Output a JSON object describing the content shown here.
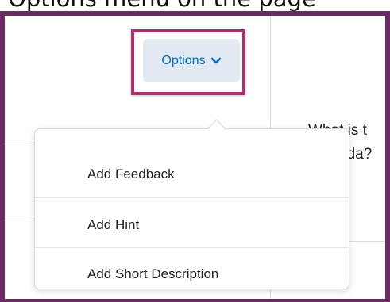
{
  "caption": "Options menu on the page",
  "background": {
    "question_lines": [
      "What is t",
      "nda?"
    ]
  },
  "options_button": {
    "label": "Options",
    "icon": "chevron-down-icon"
  },
  "menu": {
    "items": [
      {
        "label": "Add Feedback"
      },
      {
        "label": "Add Hint"
      },
      {
        "label": "Add Short Description"
      }
    ]
  },
  "colors": {
    "frame": "#6b2a64",
    "highlight": "#a8306e",
    "link_blue": "#006fbf",
    "button_bg": "#e3e9f1"
  }
}
